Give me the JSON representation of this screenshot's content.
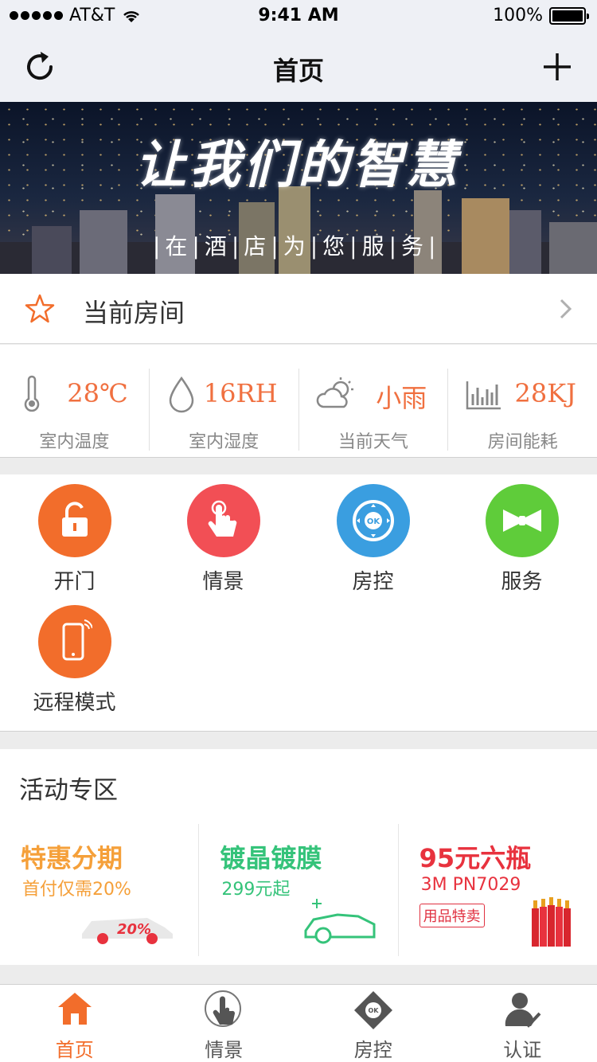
{
  "status_bar": {
    "carrier": "AT&T",
    "time": "9:41 AM",
    "battery": "100%"
  },
  "navbar": {
    "title": "首页"
  },
  "banner": {
    "headline": "让我们的智慧",
    "subline": "|在|酒|店|为|您|服|务|"
  },
  "current_room": {
    "label": "当前房间"
  },
  "stats": [
    {
      "icon": "thermometer-icon",
      "value": "28℃",
      "label": "室内温度"
    },
    {
      "icon": "droplet-icon",
      "value": "16RH",
      "label": "室内湿度"
    },
    {
      "icon": "cloud-sun-icon",
      "value": "小雨",
      "label": "当前天气"
    },
    {
      "icon": "energy-chart-icon",
      "value": "28KJ",
      "label": "房间能耗"
    }
  ],
  "functions": [
    {
      "name": "开门",
      "icon": "unlock-icon",
      "color": "#f26d2b"
    },
    {
      "name": "情景",
      "icon": "touch-hand-icon",
      "color": "#f24f55"
    },
    {
      "name": "房控",
      "icon": "remote-control-icon",
      "color": "#3a9ee0"
    },
    {
      "name": "服务",
      "icon": "bowtie-icon",
      "color": "#5fcc3a"
    },
    {
      "name": "远程模式",
      "icon": "smartphone-icon",
      "color": "#f26d2b"
    }
  ],
  "activity": {
    "heading": "活动专区",
    "cards": [
      {
        "title": "特惠分期",
        "subtitle": "首付仅需20%",
        "badge": "20%",
        "color": "#f5a03a"
      },
      {
        "title": "镀晶镀膜",
        "subtitle": "299元起",
        "color": "#35c37a"
      },
      {
        "title": "95元六瓶",
        "subtitle": "3M PN7029",
        "tag": "用品特卖",
        "color": "#e8323e"
      }
    ]
  },
  "tabbar": [
    {
      "label": "首页",
      "icon": "home-icon",
      "active": true
    },
    {
      "label": "情景",
      "icon": "touch-hand-icon",
      "active": false
    },
    {
      "label": "房控",
      "icon": "remote-control-icon",
      "active": false
    },
    {
      "label": "认证",
      "icon": "user-check-icon",
      "active": false
    }
  ],
  "colors": {
    "accent": "#f26d2b",
    "stat_value": "#f07040",
    "nav_bg": "#eef0f5"
  }
}
